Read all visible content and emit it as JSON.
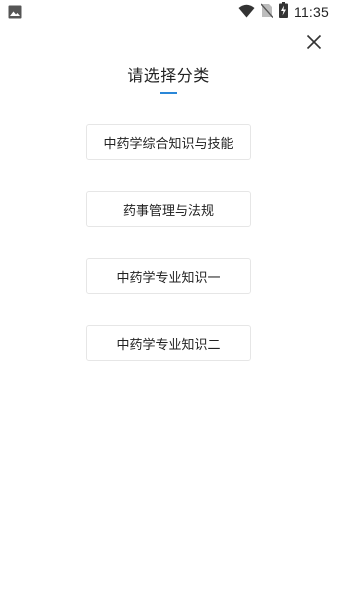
{
  "status_bar": {
    "time": "11:35",
    "left_icon": "image-icon",
    "icons": [
      "wifi-icon",
      "no-sim-icon",
      "battery-charging-icon"
    ]
  },
  "header": {
    "title": "请选择分类",
    "accent_color": "#2a87d8",
    "close_icon": "close-icon"
  },
  "categories": [
    {
      "label": "中药学综合知识与技能"
    },
    {
      "label": "药事管理与法规"
    },
    {
      "label": "中药学专业知识一"
    },
    {
      "label": "中药学专业知识二"
    }
  ]
}
